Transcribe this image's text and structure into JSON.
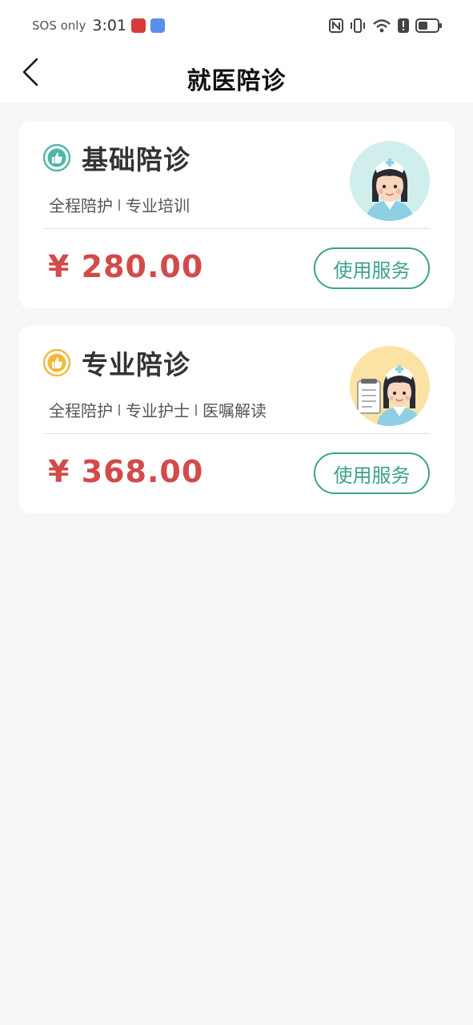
{
  "status_bar": {
    "carrier": "SOS only",
    "time": "3:01",
    "network": "6"
  },
  "header": {
    "title": "就医陪诊"
  },
  "services": [
    {
      "title": "基础陪诊",
      "tags": [
        "全程陪护",
        "专业培训"
      ],
      "price": "¥ 280.00",
      "button_label": "使用服务",
      "icon": "thumbs-up-icon",
      "icon_color": "#4fb6a8",
      "avatar_bg": "#cfeeec"
    },
    {
      "title": "专业陪诊",
      "tags": [
        "全程陪护",
        "专业护士",
        "医嘱解读"
      ],
      "price": "¥ 368.00",
      "button_label": "使用服务",
      "icon": "thumbs-up-icon",
      "icon_color": "#f0b93c",
      "avatar_bg": "#fbe3a6"
    }
  ],
  "colors": {
    "accent": "#3ba28f",
    "price": "#d24a4a",
    "background": "#f6f6f6"
  }
}
